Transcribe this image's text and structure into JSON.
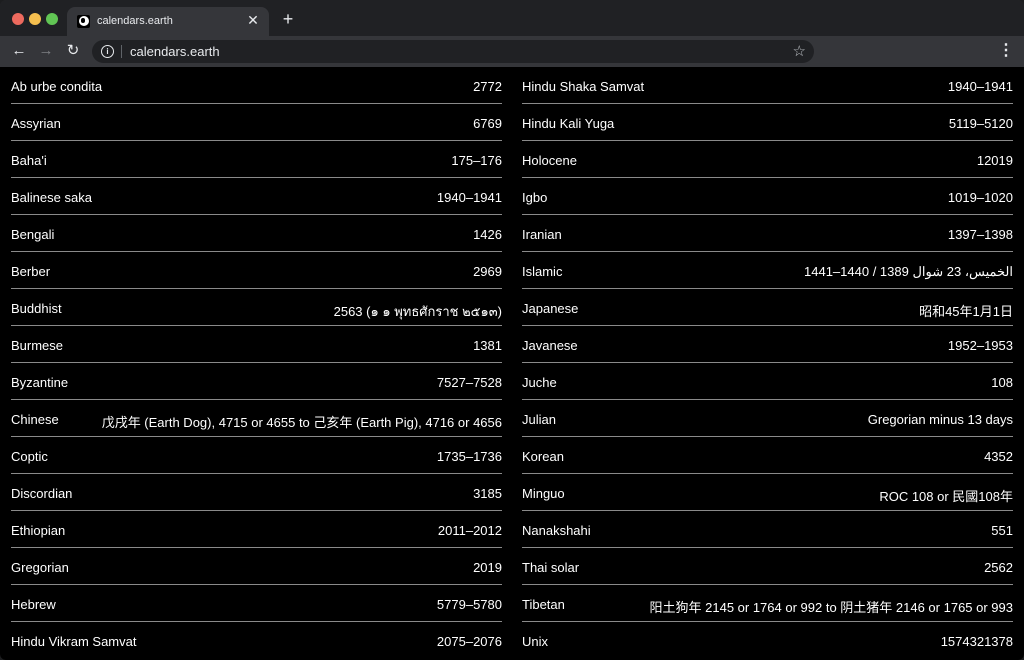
{
  "browser": {
    "tab_title": "calendars.earth",
    "tab_close": "✕",
    "new_tab": "+",
    "back": "←",
    "forward": "→",
    "reload": "↻",
    "info": "i",
    "url": "calendars.earth",
    "bookmark": "☆",
    "menu": "⋮"
  },
  "calendars_left": [
    {
      "name": "Ab urbe condita",
      "value": "2772"
    },
    {
      "name": "Assyrian",
      "value": "6769"
    },
    {
      "name": "Baha'i",
      "value": "175–176"
    },
    {
      "name": "Balinese saka",
      "value": "1940–1941"
    },
    {
      "name": "Bengali",
      "value": "1426"
    },
    {
      "name": "Berber",
      "value": "2969"
    },
    {
      "name": "Buddhist",
      "value": "2563 (๑ ๑ พุทธศักราช ๒๕๑๓)"
    },
    {
      "name": "Burmese",
      "value": "1381"
    },
    {
      "name": "Byzantine",
      "value": "7527–7528"
    },
    {
      "name": "Chinese",
      "value": "戊戌年 (Earth Dog), 4715 or 4655 to 己亥年 (Earth Pig), 4716 or 4656"
    },
    {
      "name": "Coptic",
      "value": "1735–1736"
    },
    {
      "name": "Discordian",
      "value": "3185"
    },
    {
      "name": "Ethiopian",
      "value": "2011–2012"
    },
    {
      "name": "Gregorian",
      "value": "2019"
    },
    {
      "name": "Hebrew",
      "value": "5779–5780"
    },
    {
      "name": "Hindu Vikram Samvat",
      "value": "2075–2076"
    }
  ],
  "calendars_right": [
    {
      "name": "Hindu Shaka Samvat",
      "value": "1940–1941"
    },
    {
      "name": "Hindu Kali Yuga",
      "value": "5119–5120"
    },
    {
      "name": "Holocene",
      "value": "12019"
    },
    {
      "name": "Igbo",
      "value": "1019–1020"
    },
    {
      "name": "Iranian",
      "value": "1397–1398"
    },
    {
      "name": "Islamic",
      "value": "الخميس، 23 شوال 1389 / 1440–1441"
    },
    {
      "name": "Japanese",
      "value": "昭和45年1月1日"
    },
    {
      "name": "Javanese",
      "value": "1952–1953"
    },
    {
      "name": "Juche",
      "value": "108"
    },
    {
      "name": "Julian",
      "value": "Gregorian minus 13 days"
    },
    {
      "name": "Korean",
      "value": "4352"
    },
    {
      "name": "Minguo",
      "value": "ROC 108 or 民國108年"
    },
    {
      "name": "Nanakshahi",
      "value": "551"
    },
    {
      "name": "Thai solar",
      "value": "2562"
    },
    {
      "name": "Tibetan",
      "value": "阳土狗年 2145 or 1764 or 992 to 阴土猪年 2146 or 1765 or 993"
    },
    {
      "name": "Unix",
      "value": "1574321378"
    }
  ]
}
